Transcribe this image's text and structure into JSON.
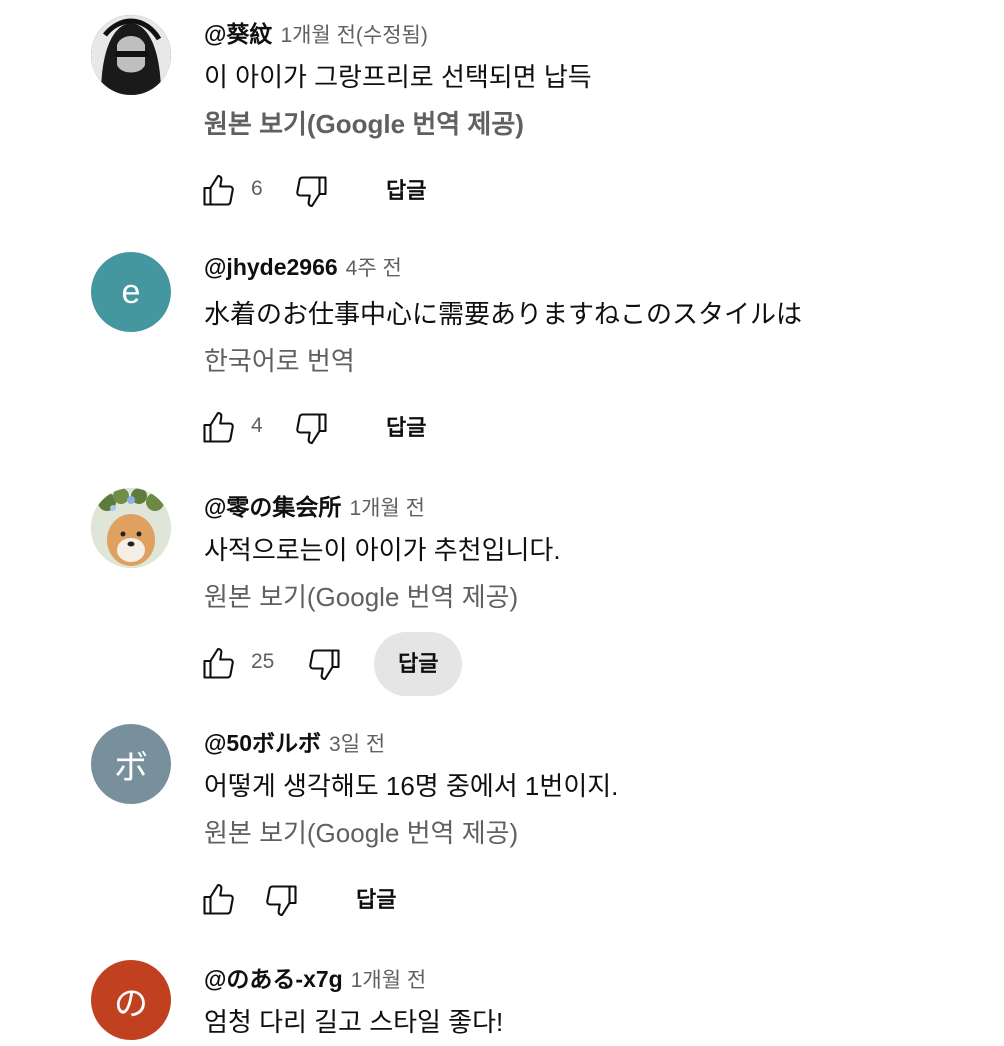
{
  "comments": [
    {
      "author": "@葵紋",
      "time": "1개월 전(수정됨)",
      "text": "이 아이가 그랑프리로 선택되면 납득",
      "translate_label": "원본 보기(Google 번역 제공)",
      "translate_bold": true,
      "likes": "6",
      "reply_label": "답글",
      "avatar": {
        "type": "image",
        "bg": "#3a3a3a"
      }
    },
    {
      "author": "@jhyde2966",
      "time": "4주 전",
      "text": "水着のお仕事中心に需要ありますねこのスタイルは",
      "translate_label": "한국어로 번역",
      "translate_bold": false,
      "likes": "4",
      "reply_label": "답글",
      "avatar": {
        "type": "letter",
        "letter": "e",
        "bg": "#45979f"
      }
    },
    {
      "author": "@零の集会所",
      "time": "1개월 전",
      "text": "사적으로는이 아이가 추천입니다.",
      "translate_label": "원본 보기(Google 번역 제공)",
      "translate_bold": false,
      "likes": "25",
      "reply_label": "답글",
      "avatar": {
        "type": "image",
        "bg": "#c9d6c0"
      }
    },
    {
      "author": "@50ボルボ",
      "time": "3일 전",
      "text": "어떻게 생각해도 16명 중에서 1번이지.",
      "translate_label": "원본 보기(Google 번역 제공)",
      "translate_bold": false,
      "likes": "",
      "reply_label": "답글",
      "avatar": {
        "type": "letter",
        "letter": "ボ",
        "bg": "#78909c"
      }
    },
    {
      "author": "@のある-x7g",
      "time": "1개월 전",
      "text": "엄청 다리 길고 스타일 좋다!",
      "translate_label": "",
      "translate_bold": false,
      "likes": "",
      "reply_label": "",
      "avatar": {
        "type": "letter",
        "letter": "の",
        "bg": "#c0401f"
      }
    }
  ],
  "icons": {
    "like": "thumbs-up-icon",
    "dislike": "thumbs-down-icon"
  }
}
